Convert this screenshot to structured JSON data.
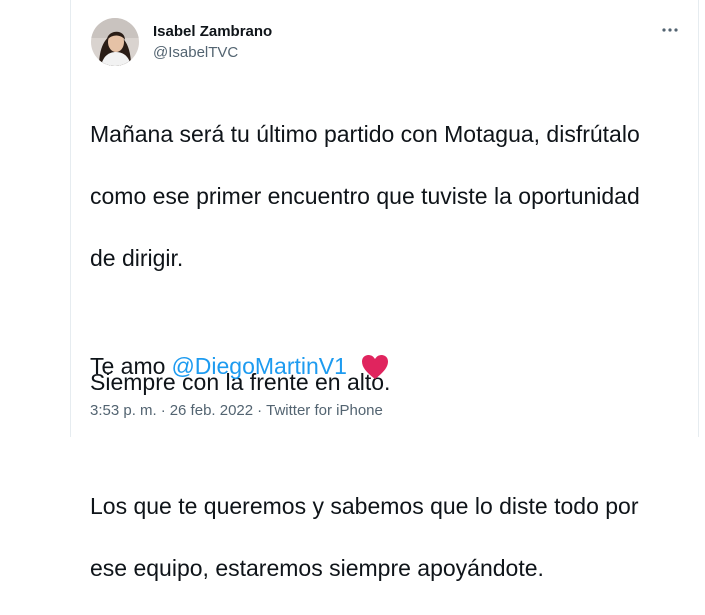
{
  "tweet": {
    "author": {
      "name": "Isabel Zambrano",
      "handle": "@IsabelTVC"
    },
    "more_icon": "more-horizontal-icon",
    "text": {
      "paragraph1": [
        "Mañana será tu último partido con Motagua, disfrútalo",
        "como ese primer encuentro que tuviste la oportunidad",
        "de dirigir."
      ],
      "paragraph2": "Siempre con la frente en alto.",
      "paragraph3": [
        "Los que te queremos y sabemos que lo diste todo por",
        "ese equipo, estaremos siempre apoyándote."
      ],
      "closing_prefix": "Te amo",
      "mention": "@DiegoMartinV1",
      "emoji": "heart-icon"
    },
    "meta": {
      "time": "3:53 p. m.",
      "separator": "·",
      "date": "26 feb. 2022",
      "source": "Twitter for iPhone"
    },
    "colors": {
      "mention": "#1d9bf0",
      "heart": "#e0245e",
      "secondary_text": "#536471"
    }
  }
}
